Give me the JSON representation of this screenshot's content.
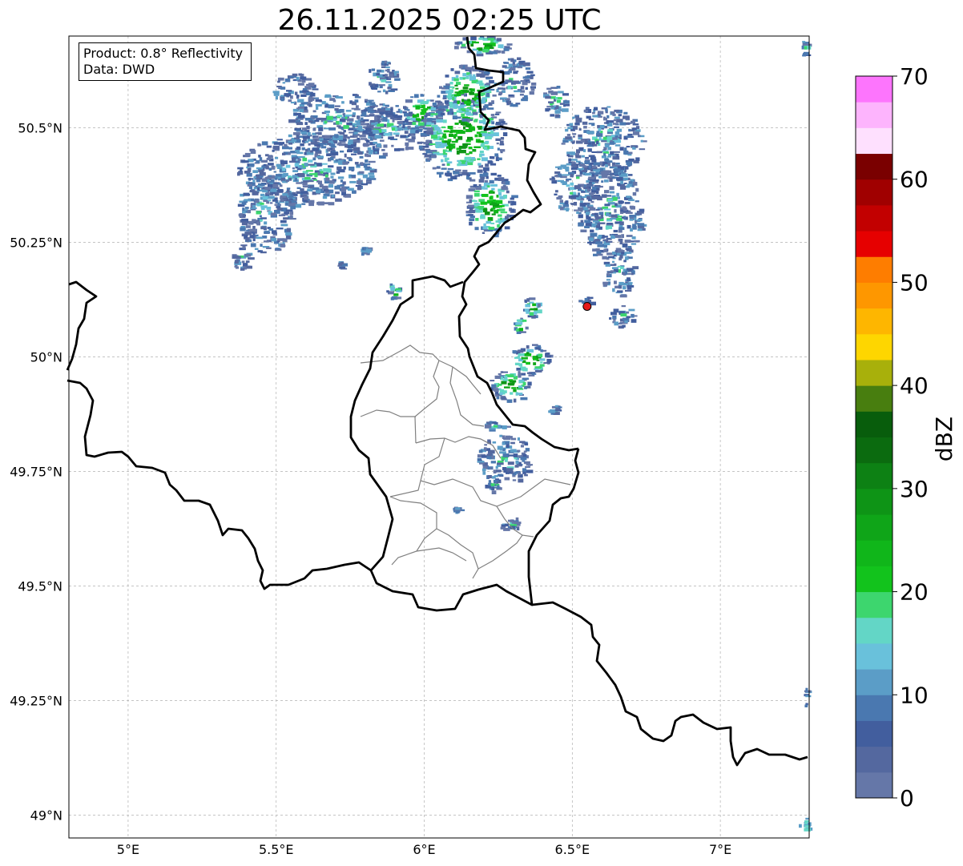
{
  "title": "26.11.2025 02:25 UTC",
  "info_box": {
    "product": "Product: 0.8° Reflectivity",
    "data": "Data: DWD"
  },
  "map": {
    "lon_range": [
      4.8,
      7.3
    ],
    "lat_range": [
      48.95,
      50.7
    ],
    "lon_ticks": [
      {
        "value": 5,
        "label": "5°E"
      },
      {
        "value": 5.5,
        "label": "5.5°E"
      },
      {
        "value": 6,
        "label": "6°E"
      },
      {
        "value": 6.5,
        "label": "6.5°E"
      },
      {
        "value": 7,
        "label": "7°E"
      }
    ],
    "lat_ticks": [
      {
        "value": 49,
        "label": "49°N"
      },
      {
        "value": 49.25,
        "label": "49.25°N"
      },
      {
        "value": 49.5,
        "label": "49.5°N"
      },
      {
        "value": 49.75,
        "label": "49.75°N"
      },
      {
        "value": 50,
        "label": "50°N"
      },
      {
        "value": 50.25,
        "label": "50.25°N"
      },
      {
        "value": 50.5,
        "label": "50.5°N"
      }
    ],
    "radar_site": {
      "lon": 6.55,
      "lat": 50.11
    },
    "colors": {
      "border": "#000000",
      "admin": "#808080",
      "grid": "#b0b0b0",
      "radar_marker": "#e51a1a"
    }
  },
  "colorbar": {
    "label": "dBZ",
    "ticks": [
      {
        "value": 0,
        "label": "0"
      },
      {
        "value": 10,
        "label": "10"
      },
      {
        "value": 20,
        "label": "20"
      },
      {
        "value": 30,
        "label": "30"
      },
      {
        "value": 40,
        "label": "40"
      },
      {
        "value": 50,
        "label": "50"
      },
      {
        "value": 60,
        "label": "60"
      },
      {
        "value": 70,
        "label": "70"
      }
    ],
    "range": [
      0,
      70
    ],
    "step": 2.5,
    "colors": [
      "#6577a8",
      "#54689f",
      "#425e9e",
      "#4a78b0",
      "#5b9dc7",
      "#69c1db",
      "#63d6c6",
      "#3dd66e",
      "#12c31c",
      "#10b61a",
      "#0fa518",
      "#0e9416",
      "#0d8114",
      "#0b6b0f",
      "#085d0c",
      "#487e0f",
      "#a8b00b",
      "#fed600",
      "#feb600",
      "#fe9700",
      "#fe7d00",
      "#e60000",
      "#c20000",
      "#a00000",
      "#7a0000",
      "#fee0fe",
      "#fdb4fd",
      "#fd75fd",
      "#ee3cee"
    ]
  }
}
